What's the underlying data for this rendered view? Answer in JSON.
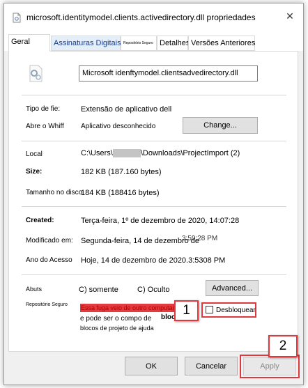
{
  "window": {
    "title": "microsoft.identitymodel.clients.activedirectory.dll propriedades",
    "close_glyph": "✕"
  },
  "tabs": [
    {
      "label": "Geral",
      "active": true
    },
    {
      "label": "Assinaturas Digitais",
      "active": false
    },
    {
      "label": "Repositório Seguro",
      "active": false
    },
    {
      "label": "Detalhes",
      "active": false
    },
    {
      "label": "Versões Anteriores",
      "active": false
    }
  ],
  "file": {
    "icon": "dll-file-gear-icon",
    "name": "Microsoft idenftymodel.clientsadvedirectory.dll"
  },
  "type": {
    "label": "Tipo de fie:",
    "value": "Extensão de aplicativo dell"
  },
  "opens_with": {
    "label": "Abre o Whiff",
    "value": "Aplicativo desconhecido",
    "button": "Change..."
  },
  "location": {
    "label": "Local",
    "value_prefix": "C:\\Users\\",
    "value_suffix": "\\Downloads\\ProjectImport (2)"
  },
  "size": {
    "label": "Size:",
    "value": "182 KB (187.160 bytes)"
  },
  "size_on_disk": {
    "label": "Tamanho no disco",
    "value": "184 KB (188416 bytes)"
  },
  "created": {
    "label": "Created:",
    "value": "Terça-feira, 1º de dezembro de 2020, 14:07:28"
  },
  "modified": {
    "label": "Modificado em:",
    "value": "Segunda-feira, 14 de dezembro de",
    "overlap": "3:59:28 PM"
  },
  "accessed": {
    "label": "Ano do Acesso",
    "value": "Hoje, 14 de dezembro de 2020.3:5308 PM"
  },
  "attributes": {
    "label": "Abuts",
    "readonly": "C) somente",
    "hidden": "C) Oculto",
    "advanced_button": "Advanced..."
  },
  "security": {
    "label": "Repositório Seguro",
    "line1": "Essa fuga veio de outro computador",
    "line2": "e pode ser o compo de",
    "line2_tail": "bloc",
    "line3": "blocos de projeto de ajuda",
    "unblock_label": "Desbloquear"
  },
  "callouts": {
    "one": "1",
    "two": "2"
  },
  "footer": {
    "ok": "OK",
    "cancel": "Cancelar",
    "apply": "Apply"
  },
  "colors": {
    "callout_red": "#e0383e",
    "highlight_red": "#e23b40"
  }
}
